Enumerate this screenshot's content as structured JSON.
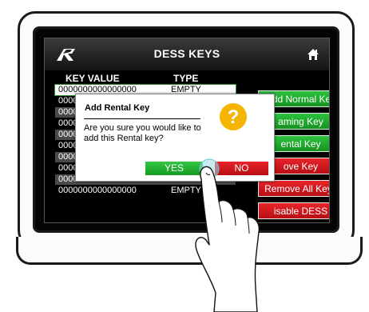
{
  "header": {
    "title": "DESS KEYS",
    "logo_icon": "brand-logo",
    "home_icon": "home-icon"
  },
  "table": {
    "headers": {
      "key": "KEY VALUE",
      "type": "TYPE"
    },
    "rows": [
      {
        "key": "0000000000000000",
        "type": "EMPTY"
      },
      {
        "key": "000000000",
        "type": ""
      },
      {
        "key": "000000000",
        "type": ""
      },
      {
        "key": "000000000",
        "type": ""
      },
      {
        "key": "000000000",
        "type": ""
      },
      {
        "key": "000000000",
        "type": ""
      },
      {
        "key": "000000000",
        "type": ""
      },
      {
        "key": "0000000000000000",
        "type": "EMPTY"
      },
      {
        "key": "0000000000000000",
        "type": "EMPTY"
      },
      {
        "key": "0000000000000000",
        "type": "EMPTY"
      }
    ]
  },
  "buttons": [
    {
      "label": "Add Normal Key",
      "color": "#1fa82c"
    },
    {
      "label": "aming Key",
      "color": "#1fa82c"
    },
    {
      "label": "ental Key",
      "color": "#1fa82c"
    },
    {
      "label": "ove Key",
      "color": "#d81a20"
    },
    {
      "label": "Remove All Keys",
      "color": "#d81a20"
    },
    {
      "label": "isable DESS",
      "color": "#d81a20"
    }
  ],
  "dialog": {
    "title": "Add Rental Key",
    "message": "Are you sure you would like to add this Rental key?",
    "yes_label": "YES",
    "no_label": "NO",
    "icon": "question-icon",
    "icon_color": "#f4b400"
  }
}
